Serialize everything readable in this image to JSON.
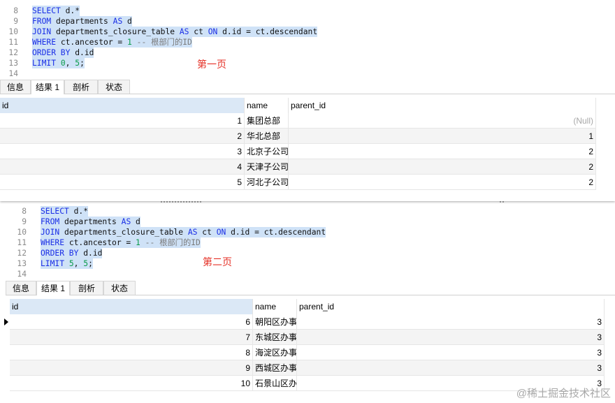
{
  "pages": [
    {
      "label": "第一页",
      "code": [
        {
          "ln": "8",
          "tokens": [
            {
              "c": "kw",
              "t": "SELECT"
            },
            {
              "c": "txt",
              "t": " d.*"
            }
          ],
          "sel": true
        },
        {
          "ln": "9",
          "tokens": [
            {
              "c": "kw",
              "t": "FROM"
            },
            {
              "c": "txt",
              "t": " departments "
            },
            {
              "c": "kw",
              "t": "AS"
            },
            {
              "c": "txt",
              "t": " d"
            }
          ],
          "sel": true
        },
        {
          "ln": "10",
          "tokens": [
            {
              "c": "kw",
              "t": "JOIN"
            },
            {
              "c": "txt",
              "t": " departments_closure_table "
            },
            {
              "c": "kw",
              "t": "AS"
            },
            {
              "c": "txt",
              "t": " ct "
            },
            {
              "c": "kw",
              "t": "ON"
            },
            {
              "c": "txt",
              "t": " d.id = ct.descendant"
            }
          ],
          "sel": true
        },
        {
          "ln": "11",
          "tokens": [
            {
              "c": "kw",
              "t": "WHERE"
            },
            {
              "c": "txt",
              "t": " ct.ancestor = "
            },
            {
              "c": "num",
              "t": "1"
            },
            {
              "c": "cmt",
              "t": " -- 根部门的ID"
            }
          ],
          "sel": true
        },
        {
          "ln": "12",
          "tokens": [
            {
              "c": "kw",
              "t": "ORDER BY"
            },
            {
              "c": "txt",
              "t": " d.id"
            }
          ],
          "sel": true
        },
        {
          "ln": "13",
          "tokens": [
            {
              "c": "kw",
              "t": "LIMIT"
            },
            {
              "c": "txt",
              "t": " "
            },
            {
              "c": "num",
              "t": "0"
            },
            {
              "c": "txt",
              "t": ", "
            },
            {
              "c": "num",
              "t": "5"
            },
            {
              "c": "txt",
              "t": ";"
            }
          ],
          "sel": true
        },
        {
          "ln": "14",
          "tokens": [],
          "sel": false
        }
      ],
      "tabs": [
        "信息",
        "结果 1",
        "剖析",
        "状态"
      ],
      "active_tab": 1,
      "columns": [
        "id",
        "name",
        "parent_id"
      ],
      "rows": [
        {
          "id": "1",
          "name": "集团总部",
          "parent_id": "(Null)",
          "is_null": true
        },
        {
          "id": "2",
          "name": "华北总部",
          "parent_id": "1"
        },
        {
          "id": "3",
          "name": "北京子公司",
          "parent_id": "2"
        },
        {
          "id": "4",
          "name": "天津子公司",
          "parent_id": "2"
        },
        {
          "id": "5",
          "name": "河北子公司",
          "parent_id": "2"
        }
      ]
    },
    {
      "label": "第二页",
      "code": [
        {
          "ln": "8",
          "tokens": [
            {
              "c": "kw",
              "t": "SELECT"
            },
            {
              "c": "txt",
              "t": " d.*"
            }
          ],
          "sel": true
        },
        {
          "ln": "9",
          "tokens": [
            {
              "c": "kw",
              "t": "FROM"
            },
            {
              "c": "txt",
              "t": " departments "
            },
            {
              "c": "kw",
              "t": "AS"
            },
            {
              "c": "txt",
              "t": " d"
            }
          ],
          "sel": true
        },
        {
          "ln": "10",
          "tokens": [
            {
              "c": "kw",
              "t": "JOIN"
            },
            {
              "c": "txt",
              "t": " departments_closure_table "
            },
            {
              "c": "kw",
              "t": "AS"
            },
            {
              "c": "txt",
              "t": " ct "
            },
            {
              "c": "kw",
              "t": "ON"
            },
            {
              "c": "txt",
              "t": " d.id = ct.descendant"
            }
          ],
          "sel": true
        },
        {
          "ln": "11",
          "tokens": [
            {
              "c": "kw",
              "t": "WHERE"
            },
            {
              "c": "txt",
              "t": " ct.ancestor = "
            },
            {
              "c": "num",
              "t": "1"
            },
            {
              "c": "cmt",
              "t": " -- 根部门的ID"
            }
          ],
          "sel": true
        },
        {
          "ln": "12",
          "tokens": [
            {
              "c": "kw",
              "t": "ORDER BY"
            },
            {
              "c": "txt",
              "t": " d.id"
            }
          ],
          "sel": true
        },
        {
          "ln": "13",
          "tokens": [
            {
              "c": "kw",
              "t": "LIMIT"
            },
            {
              "c": "txt",
              "t": " "
            },
            {
              "c": "num",
              "t": "5"
            },
            {
              "c": "txt",
              "t": ", "
            },
            {
              "c": "num",
              "t": "5"
            },
            {
              "c": "txt",
              "t": ";"
            }
          ],
          "sel": true
        },
        {
          "ln": "14",
          "tokens": [],
          "sel": false
        }
      ],
      "tabs": [
        "信息",
        "结果 1",
        "剖析",
        "状态"
      ],
      "active_tab": 1,
      "columns": [
        "id",
        "name",
        "parent_id"
      ],
      "rows": [
        {
          "id": "6",
          "name": "朝阳区办事",
          "parent_id": "3"
        },
        {
          "id": "7",
          "name": "东城区办事",
          "parent_id": "3"
        },
        {
          "id": "8",
          "name": "海淀区办事",
          "parent_id": "3"
        },
        {
          "id": "9",
          "name": "西城区办事",
          "parent_id": "3"
        },
        {
          "id": "10",
          "name": "石景山区办",
          "parent_id": "3"
        }
      ]
    }
  ],
  "watermark": "@稀土掘金技术社区",
  "colors": {
    "keyword": "#1a2ee6",
    "number": "#0b9b4a",
    "comment": "#7a7a7a",
    "selection": "#cfe2f7",
    "label": "#e53127",
    "id_header": "#dbe8f6"
  }
}
